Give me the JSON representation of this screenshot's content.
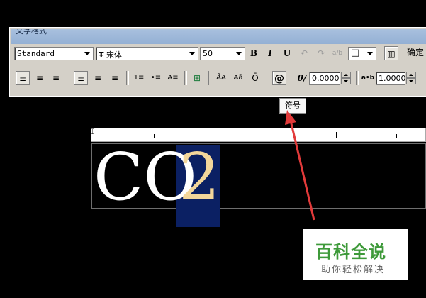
{
  "window": {
    "title": "文字格式"
  },
  "toolbar1": {
    "style_value": "Standard",
    "font_value": "宋体",
    "font_prefix": "Ŧ",
    "height_value": "50",
    "bold_label": "B",
    "italic_label": "I",
    "underline_label": "U",
    "undo_glyph": "↶",
    "redo_glyph": "↷",
    "stack_glyph": "a/b",
    "color_glyph": "□",
    "ruler_glyph": "▥",
    "confirm_label": "确定"
  },
  "toolbar2": {
    "align_left": "≡",
    "align_center": "≡",
    "align_right": "≡",
    "para_top": "≡",
    "para_mid": "≡",
    "para_bot": "≡",
    "numbered": "1≡",
    "bulleted": "•≡",
    "linespacing": "A≡",
    "insert_field": "⊞",
    "upper": "ÅA",
    "lower": "Aā",
    "overline": "Ō",
    "symbol": "@",
    "oblique_glyph": "0/",
    "oblique_value": "0.0000",
    "tracking_glyph": "a•b",
    "tracking_value": "1.0000"
  },
  "tooltip": {
    "text": "符号"
  },
  "editor": {
    "text_normal": "CO",
    "text_selected": "2"
  },
  "watermark": {
    "line1": "百科全说",
    "line2": "助你轻松解决"
  },
  "colors": {
    "selection": "#0b2063",
    "arrow": "#e23a3a",
    "watermark_green": "#3e9a3a"
  }
}
